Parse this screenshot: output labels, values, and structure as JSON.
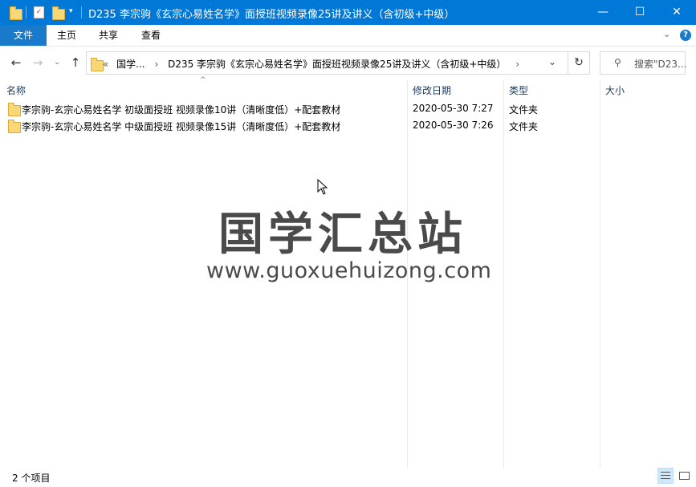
{
  "window": {
    "title": "D235 李宗驹《玄宗心易姓名学》面授班视频录像25讲及讲义（含初级+中级）",
    "minimize": "—",
    "maximize": "☐",
    "close": "✕",
    "colors": {
      "titlebar": "#0078d7",
      "file_tab": "#1979ca"
    }
  },
  "ribbon": {
    "tabs": [
      "文件",
      "主页",
      "共享",
      "查看"
    ],
    "expand_icon": "chevron-down-icon",
    "help_icon": "help-icon"
  },
  "address": {
    "overflow": "«",
    "crumbs": [
      "国学...",
      "D235 李宗驹《玄宗心易姓名学》面授班视频录像25讲及讲义（含初级+中级）"
    ],
    "separator": "›",
    "search_placeholder": "搜索\"D23..."
  },
  "columns": {
    "name": "名称",
    "modified": "修改日期",
    "type": "类型",
    "size": "大小"
  },
  "files": [
    {
      "name": "李宗驹-玄宗心易姓名学 初级面授班 视频录像10讲（清晰度低）+配套教材",
      "modified": "2020-05-30 7:27",
      "type": "文件夹",
      "size": ""
    },
    {
      "name": "李宗驹-玄宗心易姓名学 中级面授班 视频录像15讲（清晰度低）+配套教材",
      "modified": "2020-05-30 7:26",
      "type": "文件夹",
      "size": ""
    }
  ],
  "watermark": {
    "title": "国学汇总站",
    "url": "www.guoxuehuizong.com"
  },
  "status": {
    "count": "2 个项目"
  }
}
